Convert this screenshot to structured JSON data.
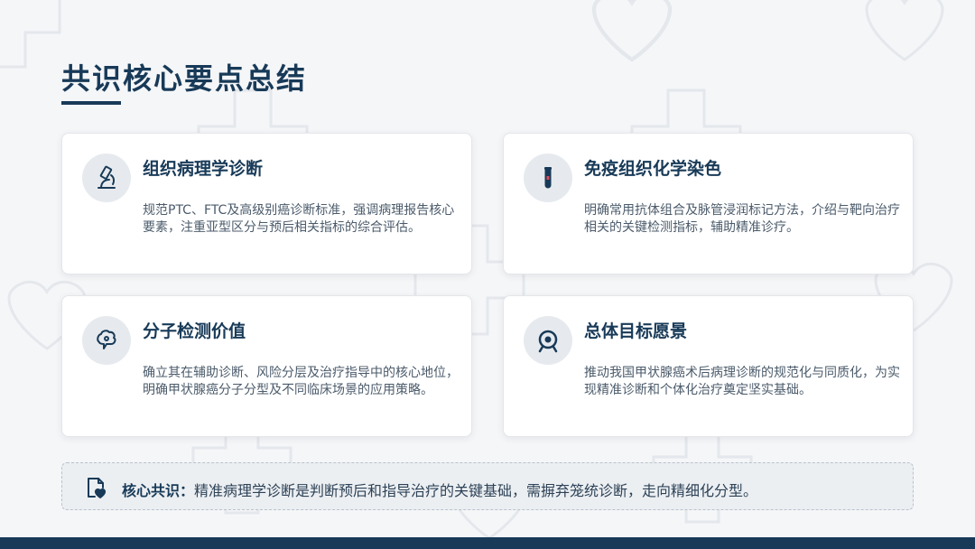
{
  "page": {
    "title": "共识核心要点总结"
  },
  "cards": [
    {
      "title": "组织病理学诊断",
      "desc": "规范PTC、FTC及高级别癌诊断标准，强调病理报告核心要素，注重亚型区分与预后相关指标的综合评估。",
      "icon": "microscope-icon"
    },
    {
      "title": "免疫组织化学染色",
      "desc": "明确常用抗体组合及脉管浸润标记方法，介绍与靶向治疗相关的关键检测指标，辅助精准诊疗。",
      "icon": "test-tube-icon"
    },
    {
      "title": "分子检测价值",
      "desc": "确立其在辅助诊断、风险分层及治疗指导中的核心地位，明确甲状腺癌分子分型及不同临床场景的应用策略。",
      "icon": "brain-icon"
    },
    {
      "title": "总体目标愿景",
      "desc": "推动我国甲状腺癌术后病理诊断的规范化与同质化，为实现精准诊断和个体化治疗奠定坚实基础。",
      "icon": "target-icon"
    }
  ],
  "summary": {
    "label": "核心共识：",
    "text": "精准病理学诊断是判断预后和指导治疗的关键基础，需摒弃笼统诊断，走向精细化分型。",
    "icon": "document-heart-icon"
  },
  "colors": {
    "primary": "#183a58",
    "background": "#f5f6f8",
    "icon_circle": "#e6eaee",
    "text_muted": "#4b5b6b"
  }
}
